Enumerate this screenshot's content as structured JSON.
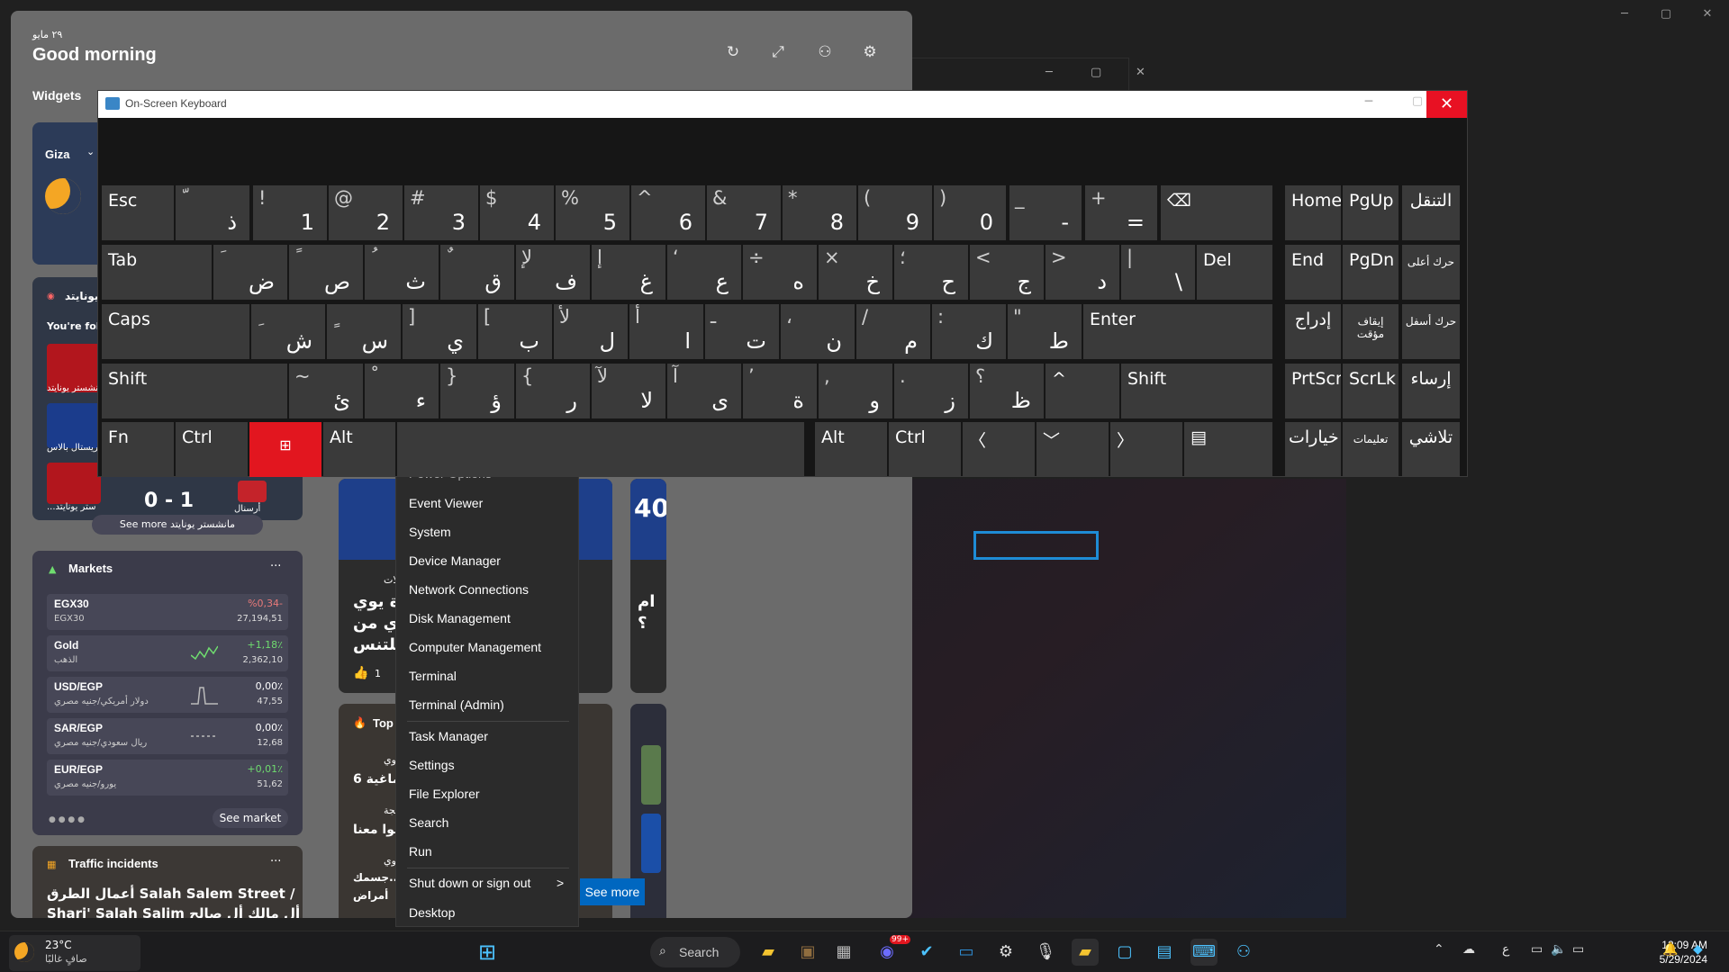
{
  "background_window": {
    "controls": [
      "─",
      "▢",
      "✕"
    ]
  },
  "middle_window": {
    "controls": [
      "─",
      "▢",
      "✕"
    ]
  },
  "widgets": {
    "date": "٢٩ مايو",
    "greeting": "Good morning",
    "title": "Widgets",
    "weather": {
      "location": "Giza"
    },
    "sports": {
      "header": "مانشستر يونايتد",
      "following": "You're foll",
      "team1": "مانشستر يونايتد",
      "team2": "كريستال بالاس",
      "team3": "...ستر يونايتد",
      "team4": "أرسنال",
      "score": "0 - 1",
      "see_more": "See more مانشستر يونايتد"
    },
    "markets": {
      "title": "Markets",
      "more": "···",
      "rows": [
        {
          "name": "EGX30",
          "sub": "EGX30",
          "change": "%0,34-",
          "value": "27,194,51",
          "color": "#e87a7a"
        },
        {
          "name": "Gold",
          "sub": "الذهب",
          "change": "+1,18٪",
          "value": "2,362,10",
          "color": "#6fdc6f"
        },
        {
          "name": "USD/EGP",
          "sub": "دولار أمريكي/جنيه مصري",
          "change": "0,00٪",
          "value": "47,55",
          "color": "#dddddd"
        },
        {
          "name": "SAR/EGP",
          "sub": "ريال سعودي/جنيه مصري",
          "change": "0,00٪",
          "value": "12,68",
          "color": "#dddddd"
        },
        {
          "name": "EUR/EGP",
          "sub": "يورو/جنيه مصري",
          "change": "+0,01٪",
          "value": "51,62",
          "color": "#6fdc6f"
        }
      ],
      "see_market": "See market"
    },
    "traffic": {
      "title": "Traffic incidents",
      "more": "···",
      "line1": "أعمال الطرق Salah Salem Street /",
      "line2": "Shari' Salah Salim أل مالك أل صالح ..."
    },
    "news1": {
      "tag": "ولات",
      "l1": "ة يوي",
      "l2": "ي من",
      "l3": "للتنس",
      "likes": "1"
    },
    "news2": {
      "big": "40",
      "l1": "ام",
      "l2": "؟"
    },
    "top": {
      "label": "Top",
      "r1a": "اوي",
      "r1b": "ماغية 6",
      "r2a": "بيجة",
      "r2b": "نوا معنا",
      "r3a": "اوي",
      "r3b": "جسمك..",
      "r3c": "أمراض"
    }
  },
  "context_menu": {
    "items": [
      "Power Options",
      "Event Viewer",
      "System",
      "Device Manager",
      "Network Connections",
      "Disk Management",
      "Computer Management",
      "Terminal",
      "Terminal (Admin)",
      "Task Manager",
      "Settings",
      "File Explorer",
      "Search",
      "Run",
      "Shut down or sign out",
      "Desktop"
    ],
    "submenu_arrow": ">"
  },
  "see_more_button": "See more",
  "osk": {
    "title": "On-Screen Keyboard",
    "min": "─",
    "max": "▢",
    "close": "✕",
    "row1": [
      {
        "lab": "Esc"
      },
      {
        "top": "ّ",
        "bot": "ذ"
      },
      {
        "top": "!",
        "bot": "1"
      },
      {
        "top": "@",
        "bot": "2"
      },
      {
        "top": "#",
        "bot": "3"
      },
      {
        "top": "$",
        "bot": "4"
      },
      {
        "top": "%",
        "bot": "5"
      },
      {
        "top": "^",
        "bot": "6"
      },
      {
        "top": "&",
        "bot": "7"
      },
      {
        "top": "*",
        "bot": "8"
      },
      {
        "top": "(",
        "bot": "9"
      },
      {
        "top": ")",
        "bot": "0"
      },
      {
        "top": "_",
        "bot": "-"
      },
      {
        "top": "+",
        "bot": "="
      },
      {
        "lab": "⌫"
      }
    ],
    "row2": [
      {
        "lab": "Tab"
      },
      {
        "top": "َ",
        "bot": "ض"
      },
      {
        "top": "ً",
        "bot": "ص"
      },
      {
        "top": "ُ",
        "bot": "ث"
      },
      {
        "top": "ٌ",
        "bot": "ق"
      },
      {
        "top": "لإ",
        "bot": "ف"
      },
      {
        "top": "إ",
        "bot": "غ"
      },
      {
        "top": "‘",
        "bot": "ع"
      },
      {
        "top": "÷",
        "bot": "ه"
      },
      {
        "top": "×",
        "bot": "خ"
      },
      {
        "top": "؛",
        "bot": "ح"
      },
      {
        "top": "<",
        "bot": "ج"
      },
      {
        "top": ">",
        "bot": "د"
      },
      {
        "top": "|",
        "bot": "\\"
      },
      {
        "lab": "Del"
      }
    ],
    "row3": [
      {
        "lab": "Caps"
      },
      {
        "top": "ِ",
        "bot": "ش"
      },
      {
        "top": "ٍ",
        "bot": "س"
      },
      {
        "top": "]",
        "bot": "ي"
      },
      {
        "top": "[",
        "bot": "ب"
      },
      {
        "top": "لأ",
        "bot": "ل"
      },
      {
        "top": "أ",
        "bot": "ا"
      },
      {
        "top": "ـ",
        "bot": "ت"
      },
      {
        "top": "،",
        "bot": "ن"
      },
      {
        "top": "/",
        "bot": "م"
      },
      {
        "top": ":",
        "bot": "ك"
      },
      {
        "top": "\"",
        "bot": "ط"
      },
      {
        "lab": "Enter"
      }
    ],
    "row4": [
      {
        "lab": "Shift"
      },
      {
        "top": "~",
        "bot": "ئ"
      },
      {
        "top": "ْ",
        "bot": "ء"
      },
      {
        "top": "}",
        "bot": "ؤ"
      },
      {
        "top": "{",
        "bot": "ر"
      },
      {
        "top": "لآ",
        "bot": "لا"
      },
      {
        "top": "آ",
        "bot": "ى"
      },
      {
        "top": "’",
        "bot": "ة"
      },
      {
        "top": ",",
        "bot": "و"
      },
      {
        "top": ".",
        "bot": "ز"
      },
      {
        "top": "؟",
        "bot": "ظ"
      },
      {
        "lab": "^"
      },
      {
        "lab": "Shift"
      }
    ],
    "row5": [
      {
        "lab": "Fn"
      },
      {
        "lab": "Ctrl"
      },
      {
        "lab": "⊞"
      },
      {
        "lab": "Alt"
      },
      {
        "lab": ""
      },
      {
        "lab": "Alt"
      },
      {
        "lab": "Ctrl"
      },
      {
        "lab": "〈"
      },
      {
        "lab": "﹀"
      },
      {
        "lab": "〉"
      },
      {
        "lab": "▤"
      }
    ],
    "nav": [
      [
        "Home",
        "PgUp",
        "التنقل"
      ],
      [
        "End",
        "PgDn",
        "حرك أعلى"
      ],
      [
        "إدراج",
        "إيقاف مؤقت",
        "حرك أسفل"
      ],
      [
        "PrtScn",
        "ScrLk",
        "إرساء"
      ],
      [
        "خيارات",
        "تعليمات",
        "تلاشي"
      ]
    ]
  },
  "taskbar": {
    "temp": "23°C",
    "condition": "صافٍ غالبًا",
    "search": "Search",
    "badge": "99+",
    "lang": "ع",
    "time": "12:09 AM",
    "date": "5/29/2024"
  }
}
